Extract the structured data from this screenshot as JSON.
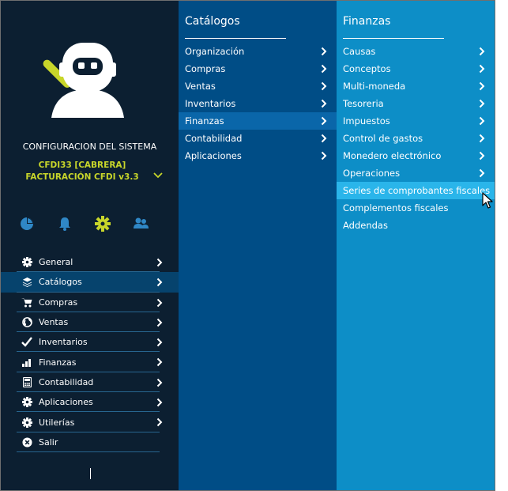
{
  "sidebar": {
    "system_title": "CONFIGURACION DEL SISTEMA",
    "company_line1": "CFDI33 [CABRERA]",
    "company_line2": "FACTURACIÓN CFDI v3.3",
    "quick_icons": [
      "dashboard-pie-icon",
      "bell-icon",
      "gear-icon",
      "users-icon"
    ],
    "menu": [
      {
        "label": "General",
        "icon": "gear-icon"
      },
      {
        "label": "Catálogos",
        "icon": "layers-icon"
      },
      {
        "label": "Compras",
        "icon": "cart-icon"
      },
      {
        "label": "Ventas",
        "icon": "globe-icon"
      },
      {
        "label": "Inventarios",
        "icon": "check-icon"
      },
      {
        "label": "Finanzas",
        "icon": "bar-chart-icon"
      },
      {
        "label": "Contabilidad",
        "icon": "calculator-icon"
      },
      {
        "label": "Aplicaciones",
        "icon": "gear-icon"
      },
      {
        "label": "Utilerías",
        "icon": "gear-icon"
      },
      {
        "label": "Salir",
        "icon": "close-circle-icon"
      }
    ],
    "active_index": 1
  },
  "catalogos": {
    "header": "Catálogos",
    "items": [
      {
        "label": "Organización"
      },
      {
        "label": "Compras"
      },
      {
        "label": "Ventas"
      },
      {
        "label": "Inventarios"
      },
      {
        "label": "Finanzas"
      },
      {
        "label": "Contabilidad"
      },
      {
        "label": "Aplicaciones"
      }
    ],
    "active_index": 4
  },
  "finanzas": {
    "header": "Finanzas",
    "items": [
      {
        "label": "Causas",
        "has_submenu": true
      },
      {
        "label": "Conceptos",
        "has_submenu": true
      },
      {
        "label": "Multi-moneda",
        "has_submenu": true
      },
      {
        "label": "Tesoreria",
        "has_submenu": true
      },
      {
        "label": "Impuestos",
        "has_submenu": true
      },
      {
        "label": "Control de gastos",
        "has_submenu": true
      },
      {
        "label": "Monedero electrónico",
        "has_submenu": true
      },
      {
        "label": "Operaciones",
        "has_submenu": true
      },
      {
        "label": "Series de comprobantes fiscales",
        "has_submenu": false
      },
      {
        "label": "Complementos fiscales",
        "has_submenu": false
      },
      {
        "label": "Addendas",
        "has_submenu": false
      }
    ],
    "hover_index": 8
  },
  "colors": {
    "sidebar_bg": "#0c1f31",
    "accent_lime": "#c8d62a",
    "column2_bg": "#004d86",
    "column3_bg": "#0d8ec7",
    "hover_bg": "#2ab5ea"
  }
}
